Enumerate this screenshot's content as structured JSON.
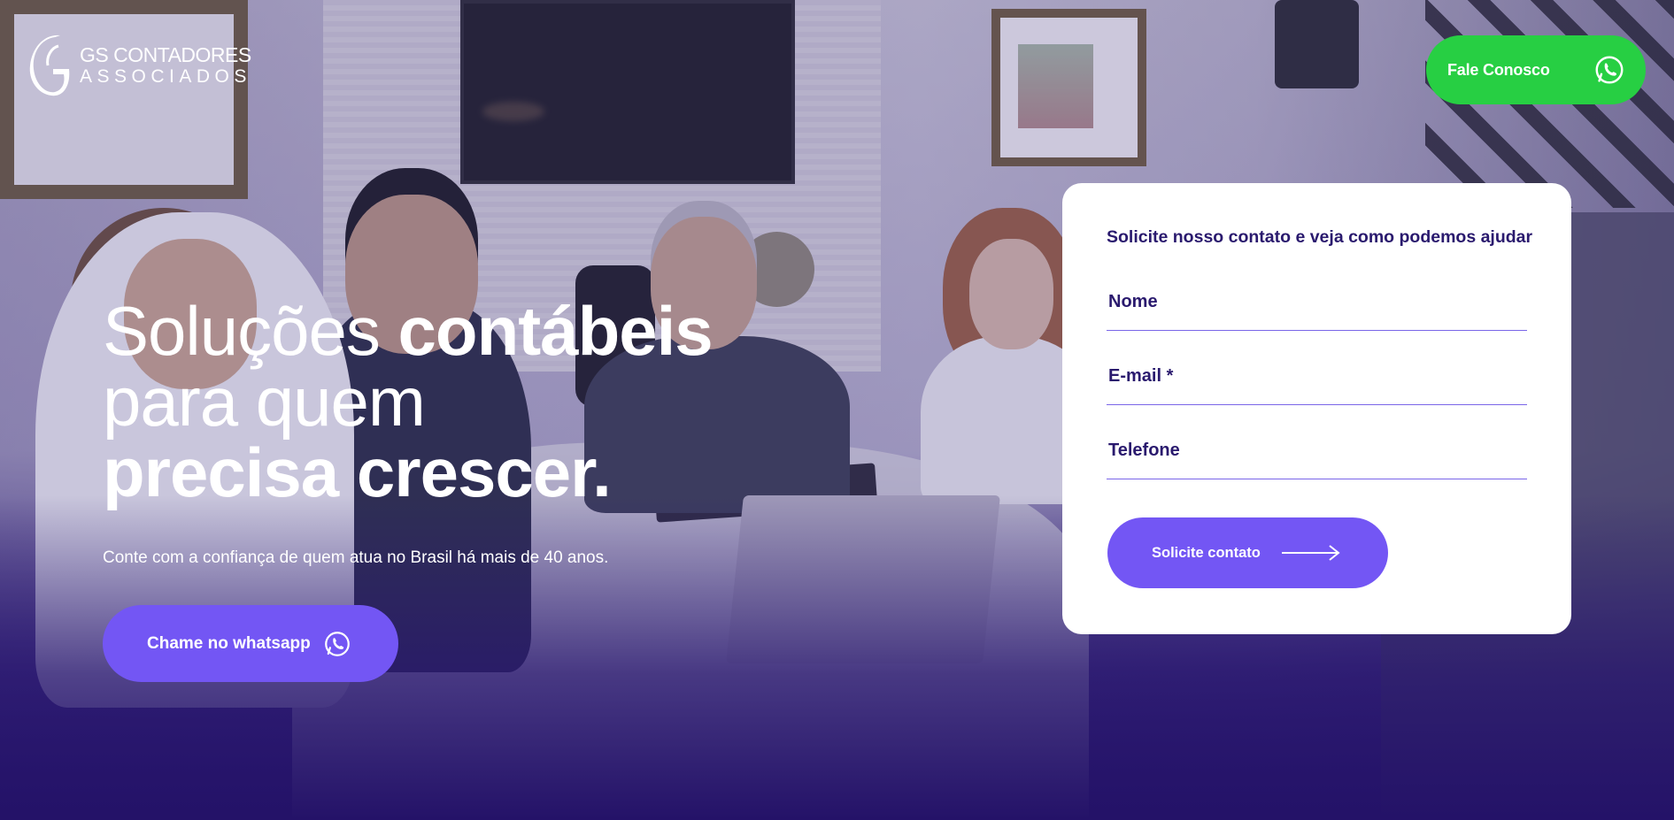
{
  "brand": {
    "line1": "GS CONTADORES",
    "line2": "ASSOCIADOS",
    "logo_icon": "gs-logo-icon"
  },
  "header": {
    "contact_button": {
      "label": "Fale Conosco",
      "icon": "whatsapp-icon",
      "color": "#27cf43"
    }
  },
  "hero": {
    "headline": {
      "part1": "Soluções ",
      "part2": "contábeis",
      "part3": "para quem",
      "part4": "precisa crescer."
    },
    "subtitle": "Conte com a confiança de quem atua no Brasil há mais de 40 anos.",
    "whatsapp_button": {
      "label": "Chame no whatsapp",
      "icon": "whatsapp-icon",
      "color": "#7356f4"
    }
  },
  "form": {
    "title": "Solicite nosso contato e veja como podemos ajudar",
    "fields": [
      {
        "placeholder": "Nome",
        "value": ""
      },
      {
        "placeholder": "E-mail *",
        "value": ""
      },
      {
        "placeholder": "Telefone",
        "value": ""
      }
    ],
    "submit": {
      "label": "Solicite contato",
      "icon": "arrow-right-icon",
      "color": "#7356f4"
    }
  }
}
